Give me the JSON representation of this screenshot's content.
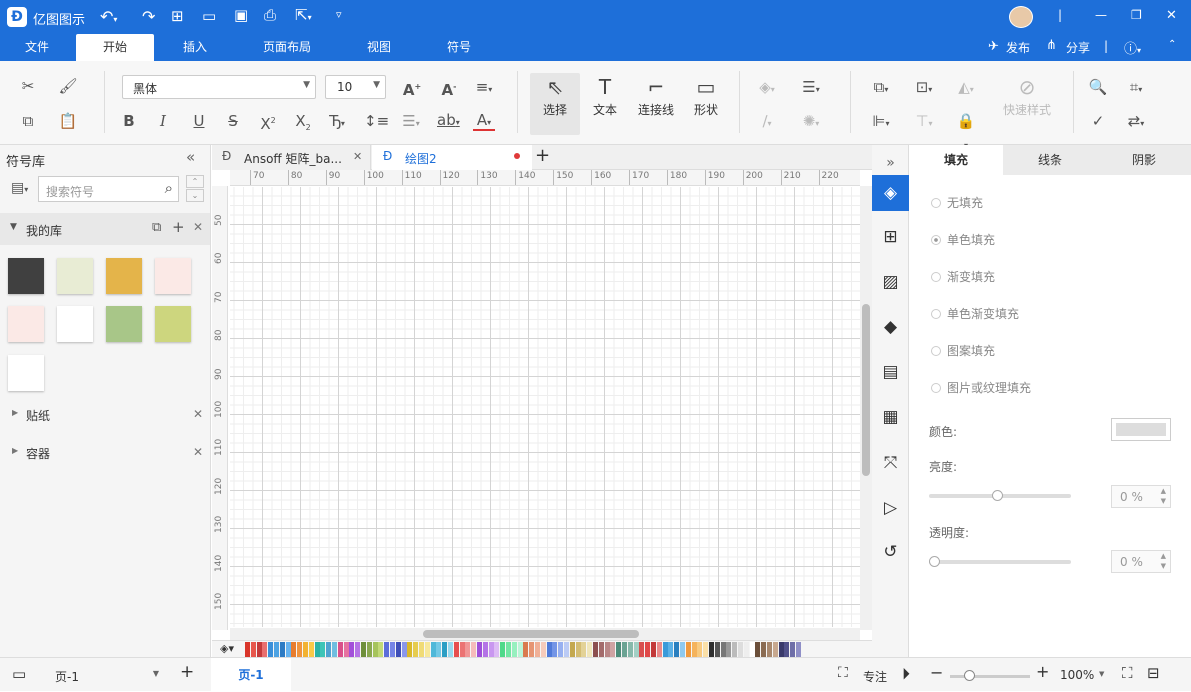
{
  "app": {
    "title": "亿图图示"
  },
  "titlebar": {
    "minimize": "—",
    "restore": "❐",
    "close": "✕"
  },
  "menu": {
    "tabs": [
      "文件",
      "开始",
      "插入",
      "页面布局",
      "视图",
      "符号"
    ],
    "active": 1,
    "publish": "发布",
    "share": "分享"
  },
  "toolbar": {
    "font_name": "黑体",
    "font_size": "10",
    "select": "选择",
    "text": "文本",
    "connector": "连接线",
    "shape": "形状",
    "quick_style": "快速样式"
  },
  "left": {
    "title": "符号库",
    "search_placeholder": "搜索符号",
    "my_library": "我的库",
    "sticker": "贴纸",
    "container": "容器",
    "swatches": [
      "#404040",
      "#e8ecd4",
      "#e4b44a",
      "#fbe9e6",
      "#fbe9e6",
      "#ffffff",
      "#a8c688",
      "#cdd67e",
      "#ffffff"
    ]
  },
  "doctabs": [
    {
      "label": "Ansoff 矩阵_ba...",
      "active": false
    },
    {
      "label": "绘图2",
      "active": true
    }
  ],
  "rulers": {
    "h": [
      "70",
      "80",
      "90",
      "100",
      "110",
      "120",
      "130",
      "140",
      "150",
      "160",
      "170",
      "180",
      "190",
      "200",
      "210",
      "220"
    ],
    "v": [
      "50",
      "60",
      "70",
      "80",
      "90",
      "100",
      "110",
      "120",
      "130",
      "140",
      "150"
    ]
  },
  "right": {
    "tabs": [
      "填充",
      "线条",
      "阴影"
    ],
    "fill_options": [
      "无填充",
      "单色填充",
      "渐变填充",
      "单色渐变填充",
      "图案填充",
      "图片或纹理填充"
    ],
    "selected_fill": 1,
    "color_label": "颜色:",
    "brightness_label": "亮度:",
    "brightness_value": "0 %",
    "opacity_label": "透明度:",
    "opacity_value": "0 %",
    "brightness_level": 0.48,
    "opacity_level": 0.0
  },
  "status": {
    "page_select": "页-1",
    "page_tab": "页-1",
    "focus": "专注",
    "zoom": "100%"
  },
  "palette": [
    "#d9362b",
    "#e7574c",
    "#c43a3a",
    "#e86f6f",
    "#3a8fd9",
    "#4ea3e3",
    "#2d7bc4",
    "#66b3f0",
    "#e87c2d",
    "#f0943e",
    "#f2b232",
    "#f7c948",
    "#2ab3a6",
    "#3dc4b7",
    "#4fa3d1",
    "#6fbde0",
    "#d94f8a",
    "#e672a1",
    "#a34fd9",
    "#b673e6",
    "#6e8f3a",
    "#8aa84f",
    "#a6c45c",
    "#c2d977",
    "#5c6ed9",
    "#7584e6",
    "#3e4fb8",
    "#8a97eb",
    "#d9b82b",
    "#e6cc4f",
    "#f0db75",
    "#f7e89b",
    "#4fb8d9",
    "#73c9e6",
    "#2b9ec4",
    "#97d9ee",
    "#e64f4f",
    "#eb7373",
    "#f09797",
    "#f5bbbb",
    "#9e4fd9",
    "#b473e6",
    "#c997f0",
    "#ddbbf5",
    "#4fd98a",
    "#73e6a4",
    "#97f0bf",
    "#bbf5d8",
    "#d97a4f",
    "#e69573",
    "#f0b097",
    "#f5cbbb",
    "#4f7ad9",
    "#7395e6",
    "#97b0f0",
    "#bbcbf5",
    "#c4a84f",
    "#d4bd73",
    "#e3d297",
    "#f0e6bb",
    "#8c4f4f",
    "#a36b6b",
    "#b98787",
    "#cfa3a3",
    "#4f8c7a",
    "#6ba393",
    "#87b9ab",
    "#a3cfc4",
    "#d94f4f",
    "#e04848",
    "#c23838",
    "#ea8a8a",
    "#3a9ad9",
    "#5ab0e6",
    "#2a7fbf",
    "#8ec9ef",
    "#f09a3e",
    "#f5b35c",
    "#f8ca80",
    "#fbe0a8",
    "#2f2f2f",
    "#555555",
    "#777777",
    "#999999",
    "#bbbbbb",
    "#dddddd",
    "#eeeeee",
    "#ffffff",
    "#6b4f3a",
    "#8a6b52",
    "#a8886e",
    "#c7a88f",
    "#3a3a6b",
    "#52528a",
    "#6e6ea8",
    "#8f8fc7"
  ]
}
